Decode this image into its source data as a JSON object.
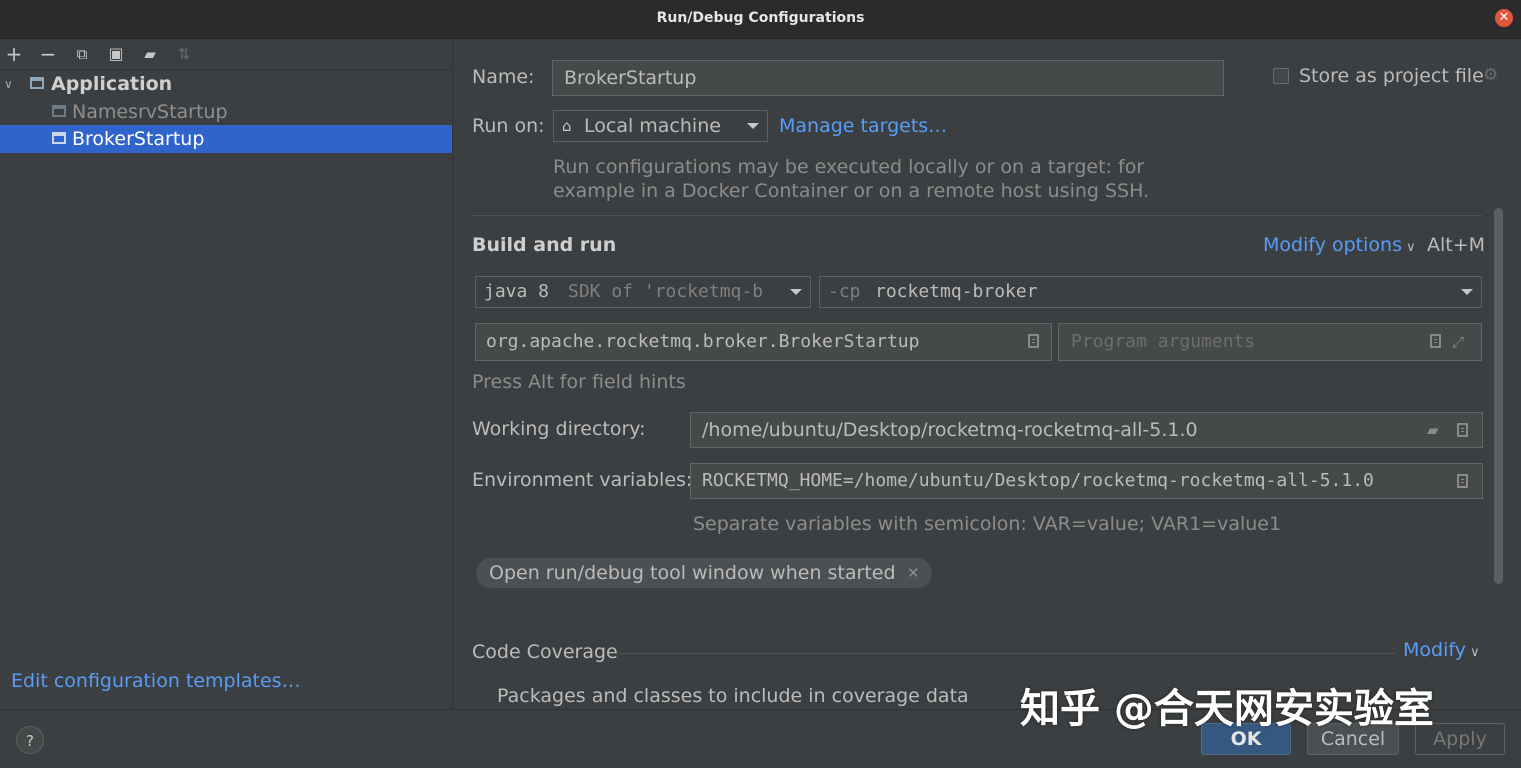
{
  "window": {
    "title": "Run/Debug Configurations"
  },
  "toolbar": {
    "icons": [
      "add-icon",
      "remove-icon",
      "copy-icon",
      "save-icon",
      "new-folder-icon",
      "sort-icon"
    ]
  },
  "tree": {
    "group_label": "Application",
    "items": [
      {
        "label": "NamesrvStartup",
        "selected": false
      },
      {
        "label": "BrokerStartup",
        "selected": true
      }
    ]
  },
  "left_footer": {
    "edit_templates": "Edit configuration templates…"
  },
  "form": {
    "name_label": "Name:",
    "name_value": "BrokerStartup",
    "store_label": "Store as project file",
    "run_on_label": "Run on:",
    "run_on_value": "Local machine",
    "manage_targets": "Manage targets…",
    "run_on_hint_line1": "Run configurations may be executed locally or on a target: for",
    "run_on_hint_line2": "example in a Docker Container or on a remote host using SSH.",
    "build_run_title": "Build and run",
    "modify_options": "Modify options",
    "modify_shortcut": "Alt+M",
    "jre_value_main": "java 8",
    "jre_value_hint": "SDK of 'rocketmq-b",
    "cp_prefix": "-cp",
    "cp_value": "rocketmq-broker",
    "main_class": "org.apache.rocketmq.broker.BrokerStartup",
    "program_args_placeholder": "Program arguments",
    "field_hints": "Press Alt for field hints",
    "working_dir_label": "Working directory:",
    "working_dir_value": "/home/ubuntu/Desktop/rocketmq-rocketmq-all-5.1.0",
    "env_label": "Environment variables:",
    "env_value": "ROCKETMQ_HOME=/home/ubuntu/Desktop/rocketmq-rocketmq-all-5.1.0",
    "env_hint": "Separate variables with semicolon: VAR=value; VAR1=value1",
    "chip_label": "Open run/debug tool window when started",
    "coverage_title": "Code Coverage",
    "coverage_modify": "Modify",
    "coverage_packages": "Packages and classes to include in coverage data"
  },
  "buttons": {
    "help": "?",
    "ok": "OK",
    "cancel": "Cancel",
    "apply": "Apply"
  },
  "watermark": "知乎 @合天网安实验室",
  "colors": {
    "accent": "#589df6",
    "selection": "#2f65ca",
    "background": "#3c3f41"
  }
}
